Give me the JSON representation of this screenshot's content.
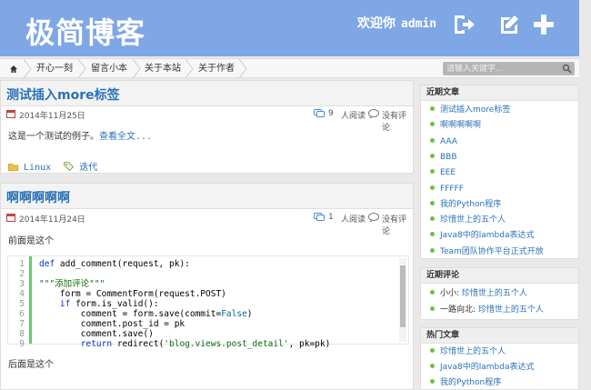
{
  "header": {
    "site_title": "极简博客",
    "welcome": "欢迎你",
    "username": "admin"
  },
  "nav": {
    "items": [
      "开心一刻",
      "留言小本",
      "关于本站",
      "关于作者"
    ],
    "search_placeholder": "请输入关键字..."
  },
  "posts": [
    {
      "title": "测试插入more标签",
      "date": "2014年11月25日",
      "read_count": "9",
      "read_label": "人阅读",
      "comments": "没有评论",
      "excerpt": "这是一个测试的例子。",
      "more_link": "查看全文...",
      "category": "Linux",
      "tag": "迭代"
    },
    {
      "title": "啊啊啊啊啊",
      "date": "2014年11月24日",
      "read_count": "1",
      "read_label": "人阅读",
      "comments": "没有评论",
      "intro": "前面是这个",
      "outro": "后面是这个"
    }
  ],
  "code_lines": [
    "def add_comment(request, pk):",
    "",
    "\"\"\"添加评论\"\"\"",
    "    form = CommentForm(request.POST)",
    "    if form.is_valid():",
    "        comment = form.save(commit=False)",
    "        comment.post_id = pk",
    "        comment.save()",
    "        return redirect('blog.views.post_detail', pk=pk)"
  ],
  "sidebar": {
    "recent_posts_title": "近期文章",
    "recent_posts": [
      "测试插入more标签",
      "啊啊啊啊啊",
      "AAA",
      "BBB",
      "EEE",
      "FFFFF",
      "我的Python程序",
      "珍惜世上的五个人",
      "Java8中的lambda表达式",
      "Team团队协作平台正式开放"
    ],
    "recent_comments_title": "近期评论",
    "recent_comments": [
      {
        "who": "小小",
        "sep": ": ",
        "post": "珍惜世上的五个人"
      },
      {
        "who": "一路向北",
        "sep": ": ",
        "post": "珍惜世上的五个人"
      }
    ],
    "hot_posts_title": "热门文章",
    "hot_posts": [
      "珍惜世上的五个人",
      "Java8中的lambda表达式",
      "我的Python程序"
    ]
  },
  "colors": {
    "header_bg": "#7fa6e5",
    "link": "#2a72b8",
    "bullet": "#6cbf4a"
  }
}
